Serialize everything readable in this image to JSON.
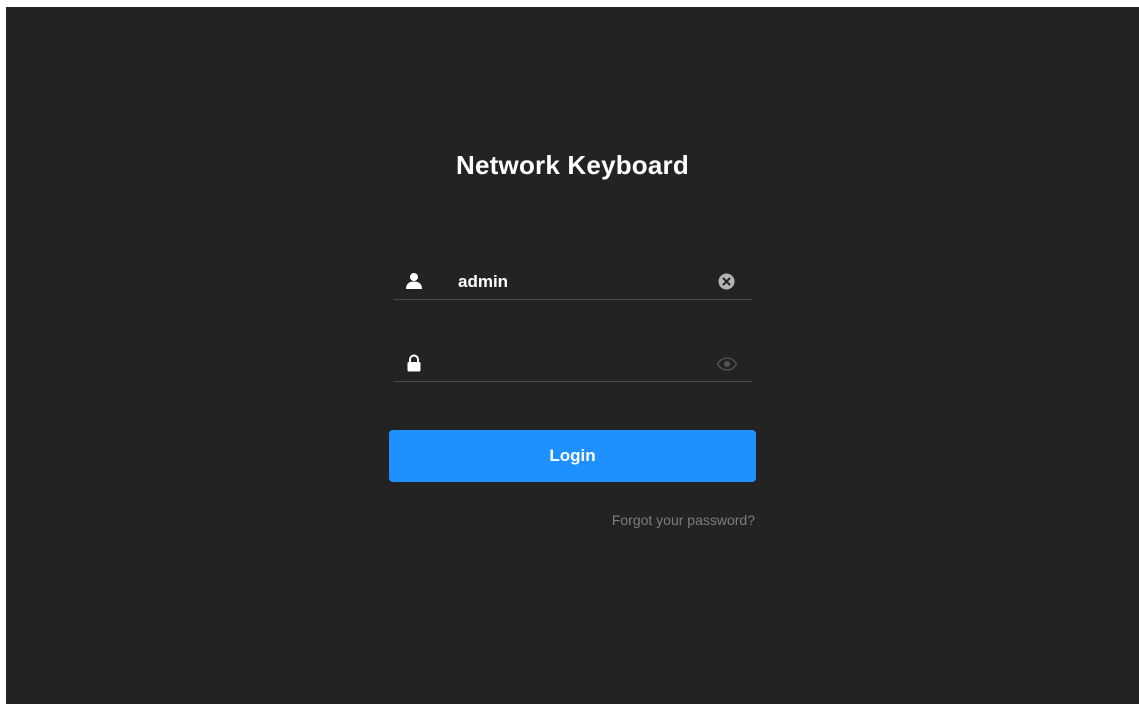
{
  "app": {
    "title": "Network Keyboard"
  },
  "login_form": {
    "username": {
      "icon": "user-icon",
      "value": "admin",
      "clear_icon": "clear-icon"
    },
    "password": {
      "icon": "lock-icon",
      "value": "",
      "visibility_icon": "eye-icon"
    },
    "login_label": "Login",
    "forgot_password_label": "Forgot your password?"
  },
  "colors": {
    "background": "#232323",
    "accent": "#1e90ff",
    "text": "#ffffff",
    "muted_text": "#7d7d7d",
    "field_underline": "#4a4a4a"
  }
}
